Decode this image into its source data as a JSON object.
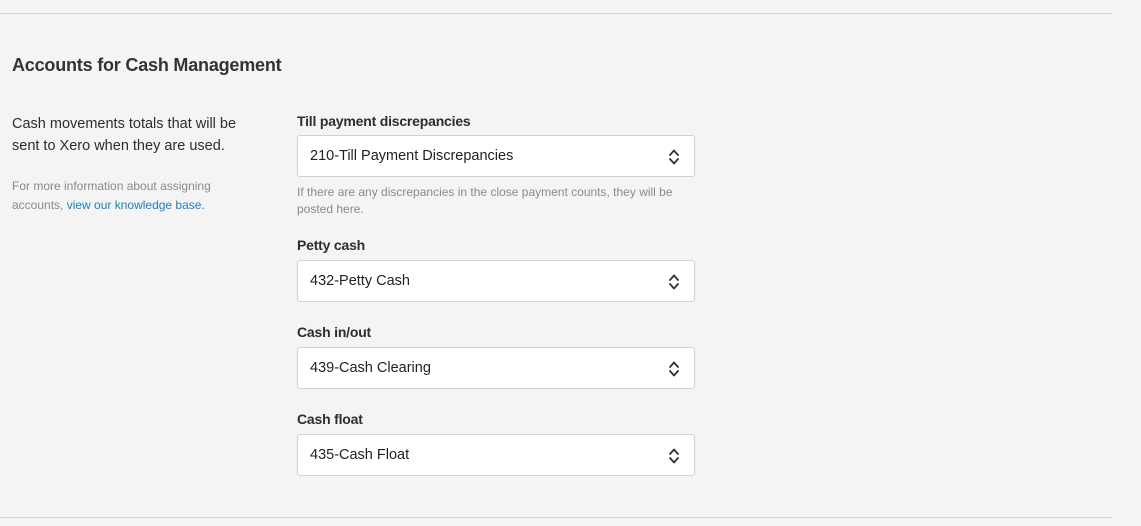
{
  "section": {
    "title": "Accounts for Cash Management",
    "description": "Cash movements totals that will be sent to Xero when they are used.",
    "help_prefix": "For more information about assigning accounts, ",
    "help_link": "view our knowledge base."
  },
  "fields": [
    {
      "label": "Till payment discrepancies",
      "value": "210-Till Payment Discrepancies",
      "hint": "If there are any discrepancies in the close payment counts, they will be posted here."
    },
    {
      "label": "Petty cash",
      "value": "432-Petty Cash"
    },
    {
      "label": "Cash in/out",
      "value": "439-Cash Clearing"
    },
    {
      "label": "Cash float",
      "value": "435-Cash Float"
    }
  ],
  "colors": {
    "link": "#1d7fc4",
    "background": "#f4f4f4"
  },
  "icons": {
    "select_arrows": "up-down-chevron-icon"
  }
}
